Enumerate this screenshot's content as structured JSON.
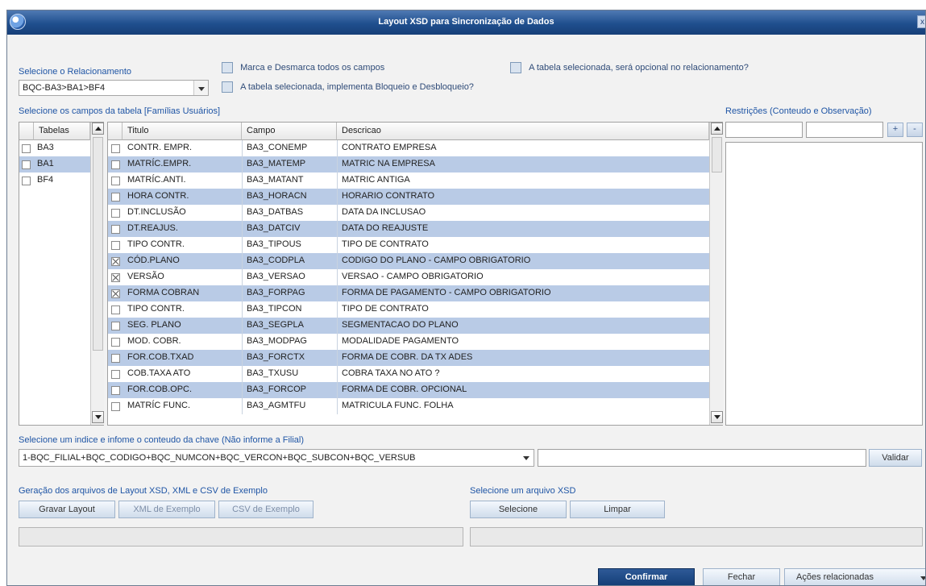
{
  "window": {
    "title": "Layout XSD para Sincronização de Dados",
    "close_label": "x"
  },
  "relationship": {
    "label": "Selecione o Relacionamento",
    "value": "BQC-BA3>BA1>BF4"
  },
  "options": {
    "mark_all": "Marca e Desmarca todos os campos",
    "optional": "A tabela selecionada, será opcional no relacionamento?",
    "blocking": "A tabela selecionada, implementa Bloqueio e Desbloqueio?"
  },
  "fields_label": "Selecione os campos da tabela [Famílias Usuários]",
  "tables": {
    "header": "Tabelas",
    "items": [
      {
        "name": "BA3",
        "checked": false,
        "selected": false
      },
      {
        "name": "BA1",
        "checked": false,
        "selected": true
      },
      {
        "name": "BF4",
        "checked": false,
        "selected": false
      }
    ]
  },
  "fields": {
    "headers": {
      "titulo": "Titulo",
      "campo": "Campo",
      "descricao": "Descricao"
    },
    "rows": [
      {
        "titulo": "CONTR. EMPR.",
        "campo": "BA3_CONEMP",
        "descricao": "CONTRATO EMPRESA",
        "checked": false
      },
      {
        "titulo": "MATRÍC.EMPR.",
        "campo": "BA3_MATEMP",
        "descricao": "MATRIC NA EMPRESA",
        "checked": false
      },
      {
        "titulo": "MATRÍC.ANTI.",
        "campo": "BA3_MATANT",
        "descricao": "MATRIC ANTIGA",
        "checked": false
      },
      {
        "titulo": "HORA CONTR.",
        "campo": "BA3_HORACN",
        "descricao": "HORARIO CONTRATO",
        "checked": false
      },
      {
        "titulo": "DT.INCLUSÃO",
        "campo": "BA3_DATBAS",
        "descricao": "DATA DA INCLUSAO",
        "checked": false
      },
      {
        "titulo": "DT.REAJUS.",
        "campo": "BA3_DATCIV",
        "descricao": "DATA DO REAJUSTE",
        "checked": false
      },
      {
        "titulo": "TIPO CONTR.",
        "campo": "BA3_TIPOUS",
        "descricao": "TIPO DE CONTRATO",
        "checked": false
      },
      {
        "titulo": "CÓD.PLANO",
        "campo": "BA3_CODPLA",
        "descricao": "CODIGO DO PLANO - CAMPO OBRIGATORIO",
        "checked": true
      },
      {
        "titulo": "VERSÃO",
        "campo": "BA3_VERSAO",
        "descricao": "VERSAO - CAMPO OBRIGATORIO",
        "checked": true
      },
      {
        "titulo": "FORMA COBRAN",
        "campo": "BA3_FORPAG",
        "descricao": "FORMA DE PAGAMENTO - CAMPO OBRIGATORIO",
        "checked": true
      },
      {
        "titulo": "TIPO CONTR.",
        "campo": "BA3_TIPCON",
        "descricao": "TIPO DE CONTRATO",
        "checked": false
      },
      {
        "titulo": "SEG. PLANO",
        "campo": "BA3_SEGPLA",
        "descricao": "SEGMENTACAO DO PLANO",
        "checked": false
      },
      {
        "titulo": "MOD. COBR.",
        "campo": "BA3_MODPAG",
        "descricao": "MODALIDADE PAGAMENTO",
        "checked": false
      },
      {
        "titulo": "FOR.COB.TXAD",
        "campo": "BA3_FORCTX",
        "descricao": "FORMA DE COBR. DA TX ADES",
        "checked": false
      },
      {
        "titulo": "COB.TAXA ATO",
        "campo": "BA3_TXUSU",
        "descricao": "COBRA TAXA NO ATO ?",
        "checked": false
      },
      {
        "titulo": "FOR.COB.OPC.",
        "campo": "BA3_FORCOP",
        "descricao": "FORMA DE COBR. OPCIONAL",
        "checked": false
      },
      {
        "titulo": "MATRÍC FUNC.",
        "campo": "BA3_AGMTFU",
        "descricao": "MATRICULA FUNC. FOLHA",
        "checked": false
      }
    ]
  },
  "restrictions": {
    "label": "Restrições (Conteudo e Observação)",
    "add_label": "+",
    "remove_label": "-"
  },
  "index": {
    "label": "Selecione um indice e infome o conteudo da chave (Não informe a Filial)",
    "value": "1-BQC_FILIAL+BQC_CODIGO+BQC_NUMCON+BQC_VERCON+BQC_SUBCON+BQC_VERSUB",
    "validate_label": "Validar"
  },
  "generation": {
    "label": "Geração dos arquivos de Layout XSD, XML e CSV de Exemplo",
    "save_layout": "Gravar Layout",
    "xml_example": "XML de Exemplo",
    "csv_example": "CSV de Exemplo"
  },
  "xsd": {
    "label": "Selecione um arquivo XSD",
    "select": "Selecione",
    "clear": "Limpar"
  },
  "footer": {
    "confirm": "Confirmar",
    "close": "Fechar",
    "actions": "Ações relacionadas"
  }
}
